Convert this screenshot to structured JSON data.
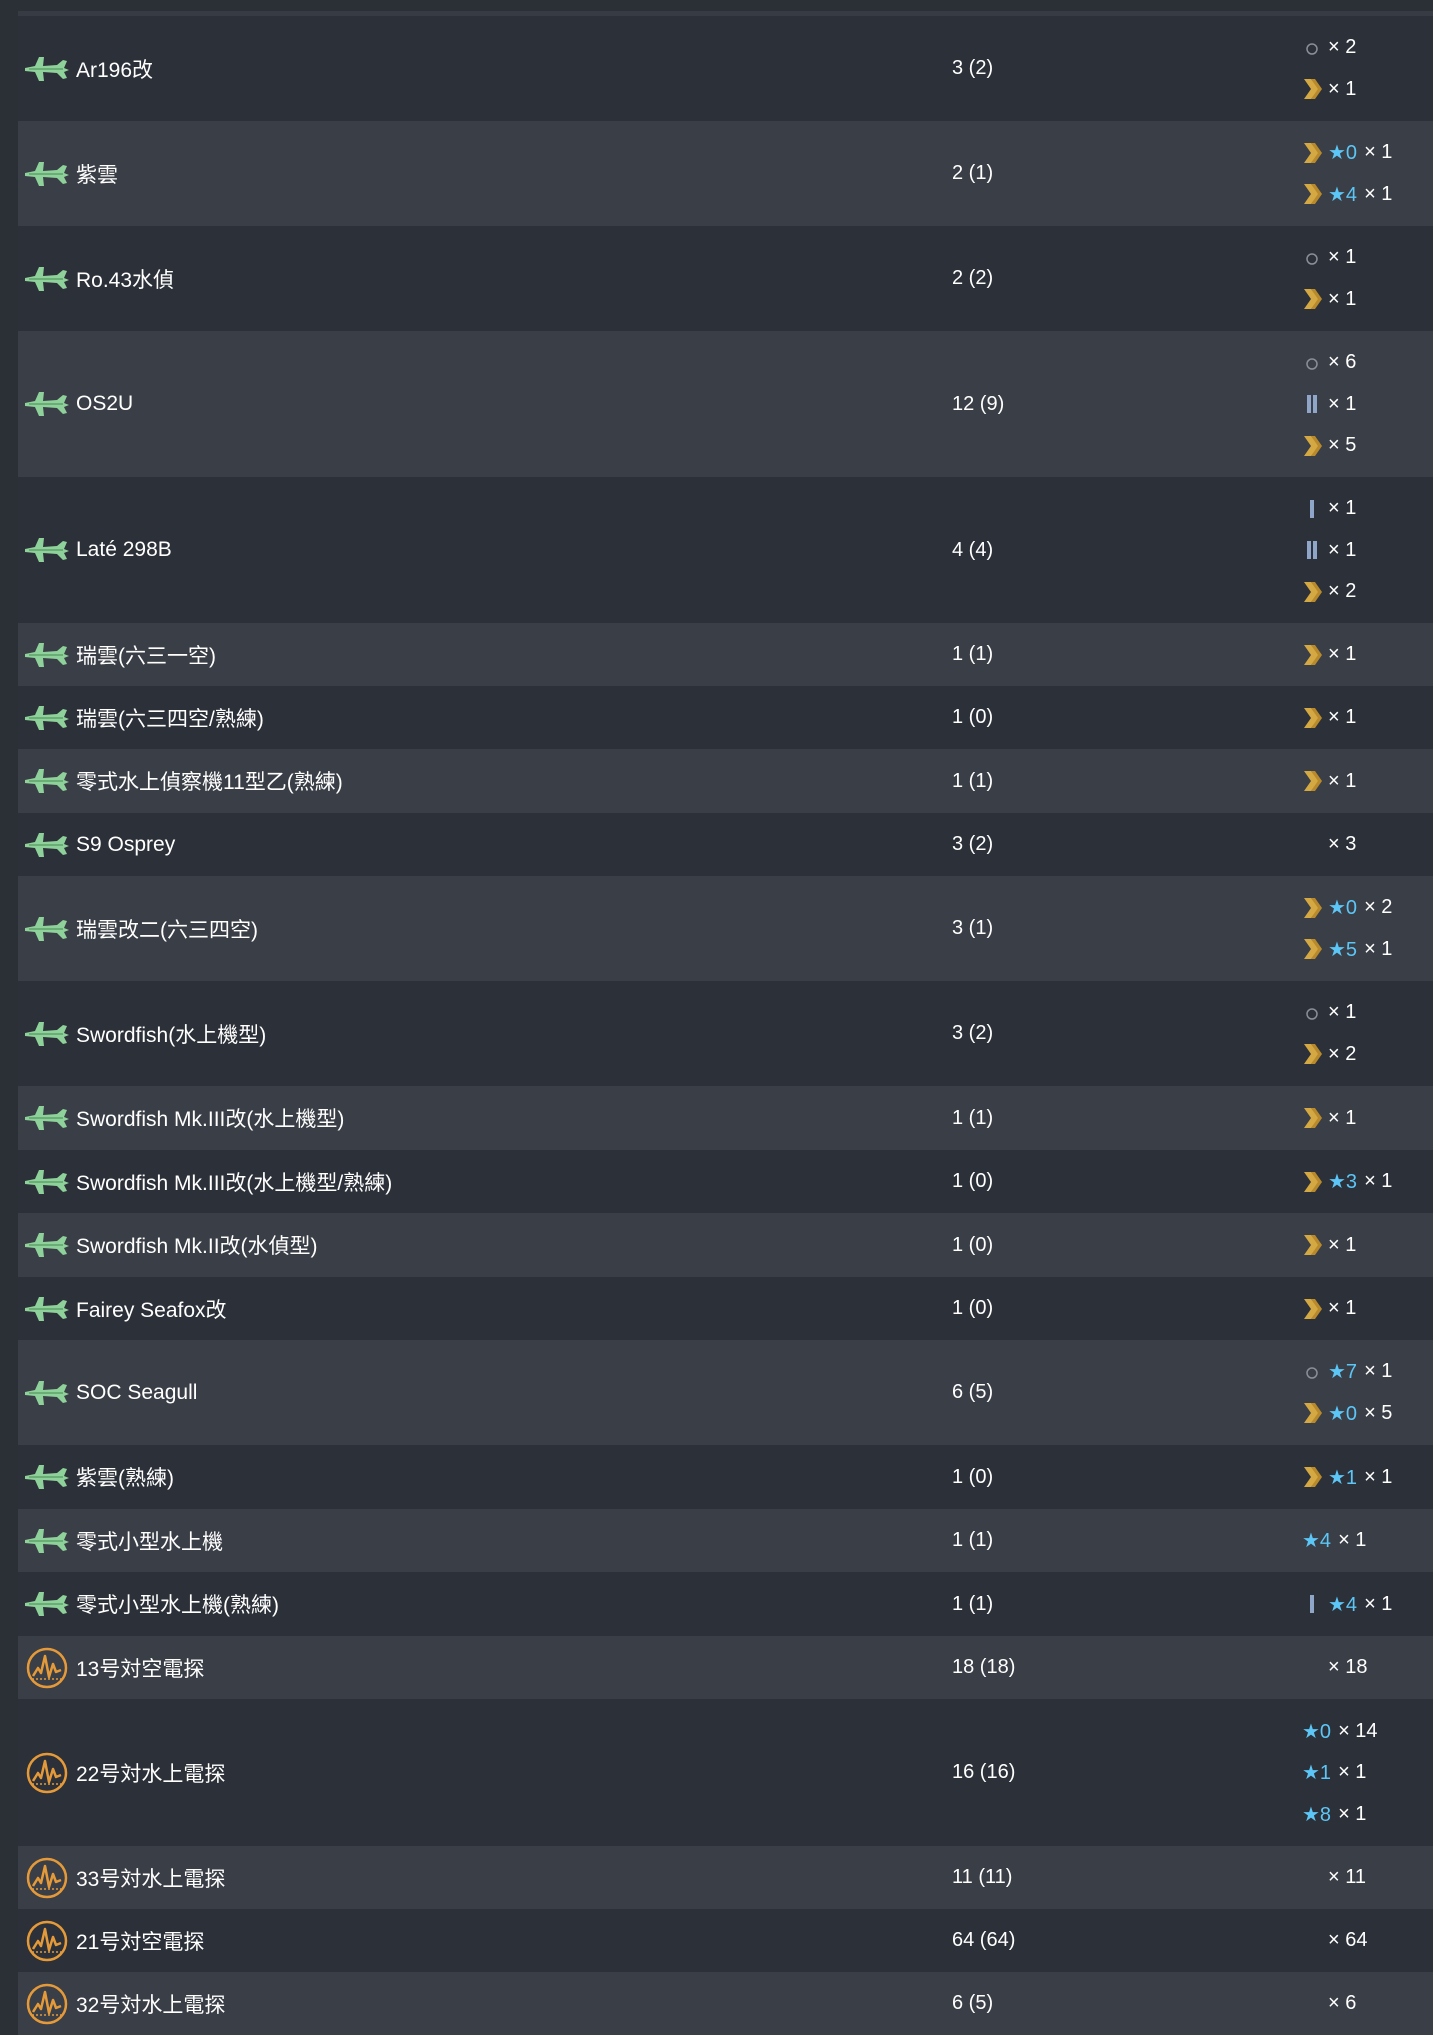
{
  "rows": [
    {
      "icon": "seaplane-icon",
      "name": "Ar196改",
      "count": "3 (2)",
      "prof": [
        {
          "lv": "none",
          "star": "",
          "qty": "× 2"
        },
        {
          "lv": "ace",
          "star": "",
          "qty": "× 1"
        }
      ]
    },
    {
      "icon": "seaplane-icon",
      "name": "紫雲",
      "count": "2 (1)",
      "prof": [
        {
          "lv": "ace",
          "star": "★0",
          "qty": "× 1"
        },
        {
          "lv": "ace",
          "star": "★4",
          "qty": "× 1"
        }
      ]
    },
    {
      "icon": "seaplane-icon",
      "name": "Ro.43水偵",
      "count": "2 (2)",
      "prof": [
        {
          "lv": "none",
          "star": "",
          "qty": "× 1"
        },
        {
          "lv": "ace",
          "star": "",
          "qty": "× 1"
        }
      ]
    },
    {
      "icon": "seaplane-icon",
      "name": "OS2U",
      "count": "12 (9)",
      "prof": [
        {
          "lv": "none",
          "star": "",
          "qty": "× 6"
        },
        {
          "lv": "bar2",
          "star": "",
          "qty": "× 1"
        },
        {
          "lv": "ace",
          "star": "",
          "qty": "× 5"
        }
      ]
    },
    {
      "icon": "seaplane-icon",
      "name": "Laté 298B",
      "count": "4 (4)",
      "prof": [
        {
          "lv": "bar1",
          "star": "",
          "qty": "× 1"
        },
        {
          "lv": "bar2",
          "star": "",
          "qty": "× 1"
        },
        {
          "lv": "ace",
          "star": "",
          "qty": "× 2"
        }
      ]
    },
    {
      "icon": "seaplane-icon",
      "name": "瑞雲(六三一空)",
      "count": "1 (1)",
      "prof": [
        {
          "lv": "ace",
          "star": "",
          "qty": "× 1"
        }
      ]
    },
    {
      "icon": "seaplane-icon",
      "name": "瑞雲(六三四空/熟練)",
      "count": "1 (0)",
      "prof": [
        {
          "lv": "ace",
          "star": "",
          "qty": "× 1"
        }
      ]
    },
    {
      "icon": "seaplane-icon",
      "name": "零式水上偵察機11型乙(熟練)",
      "count": "1 (1)",
      "prof": [
        {
          "lv": "ace",
          "star": "",
          "qty": "× 1"
        }
      ]
    },
    {
      "icon": "seaplane-icon",
      "name": "S9 Osprey",
      "count": "3 (2)",
      "prof": [
        {
          "lv": "blank",
          "star": "",
          "qty": "× 3"
        }
      ]
    },
    {
      "icon": "seaplane-icon",
      "name": "瑞雲改二(六三四空)",
      "count": "3 (1)",
      "prof": [
        {
          "lv": "ace",
          "star": "★0",
          "qty": "× 2"
        },
        {
          "lv": "ace",
          "star": "★5",
          "qty": "× 1"
        }
      ]
    },
    {
      "icon": "seaplane-icon",
      "name": "Swordfish(水上機型)",
      "count": "3 (2)",
      "prof": [
        {
          "lv": "none",
          "star": "",
          "qty": "× 1"
        },
        {
          "lv": "ace",
          "star": "",
          "qty": "× 2"
        }
      ]
    },
    {
      "icon": "seaplane-icon",
      "name": "Swordfish Mk.III改(水上機型)",
      "count": "1 (1)",
      "prof": [
        {
          "lv": "ace",
          "star": "",
          "qty": "× 1"
        }
      ]
    },
    {
      "icon": "seaplane-icon",
      "name": "Swordfish Mk.III改(水上機型/熟練)",
      "count": "1 (0)",
      "prof": [
        {
          "lv": "ace",
          "star": "★3",
          "qty": "× 1"
        }
      ]
    },
    {
      "icon": "seaplane-icon",
      "name": "Swordfish Mk.II改(水偵型)",
      "count": "1 (0)",
      "prof": [
        {
          "lv": "ace",
          "star": "",
          "qty": "× 1"
        }
      ]
    },
    {
      "icon": "seaplane-icon",
      "name": "Fairey Seafox改",
      "count": "1 (0)",
      "prof": [
        {
          "lv": "ace",
          "star": "",
          "qty": "× 1"
        }
      ]
    },
    {
      "icon": "seaplane-icon",
      "name": "SOC Seagull",
      "count": "6 (5)",
      "prof": [
        {
          "lv": "none",
          "star": "★7",
          "qty": "× 1"
        },
        {
          "lv": "ace",
          "star": "★0",
          "qty": "× 5"
        }
      ]
    },
    {
      "icon": "seaplane-icon",
      "name": "紫雲(熟練)",
      "count": "1 (0)",
      "prof": [
        {
          "lv": "ace",
          "star": "★1",
          "qty": "× 1"
        }
      ]
    },
    {
      "icon": "seaplane-icon",
      "name": "零式小型水上機",
      "count": "1 (1)",
      "prof": [
        {
          "lv": "nospace",
          "star": "★4",
          "qty": "× 1"
        }
      ]
    },
    {
      "icon": "seaplane-icon",
      "name": "零式小型水上機(熟練)",
      "count": "1 (1)",
      "prof": [
        {
          "lv": "bar1",
          "star": "★4",
          "qty": "× 1"
        }
      ]
    },
    {
      "icon": "radar-icon",
      "name": "13号対空電探",
      "count": "18 (18)",
      "prof": [
        {
          "lv": "blank",
          "star": "",
          "qty": "× 18"
        }
      ]
    },
    {
      "icon": "radar-icon",
      "name": "22号対水上電探",
      "count": "16 (16)",
      "prof": [
        {
          "lv": "nospace",
          "star": "★0",
          "qty": "× 14"
        },
        {
          "lv": "nospace",
          "star": "★1",
          "qty": "× 1"
        },
        {
          "lv": "nospace",
          "star": "★8",
          "qty": "× 1"
        }
      ]
    },
    {
      "icon": "radar-icon",
      "name": "33号対水上電探",
      "count": "11 (11)",
      "prof": [
        {
          "lv": "blank",
          "star": "",
          "qty": "× 11"
        }
      ]
    },
    {
      "icon": "radar-icon",
      "name": "21号対空電探",
      "count": "64 (64)",
      "prof": [
        {
          "lv": "blank",
          "star": "",
          "qty": "× 64"
        }
      ]
    },
    {
      "icon": "radar-icon",
      "name": "32号対水上電探",
      "count": "6 (5)",
      "prof": [
        {
          "lv": "blank",
          "star": "",
          "qty": "× 6"
        }
      ]
    }
  ],
  "colors": {
    "bg": "#2b2f36",
    "row_odd": "#2c3038",
    "row_even": "#3a3e46",
    "star": "#5cc6f7",
    "ace": "#d4a842",
    "bar": "#8fa6c8",
    "plane": "#8fd19a",
    "radar": "#e59a3a"
  }
}
